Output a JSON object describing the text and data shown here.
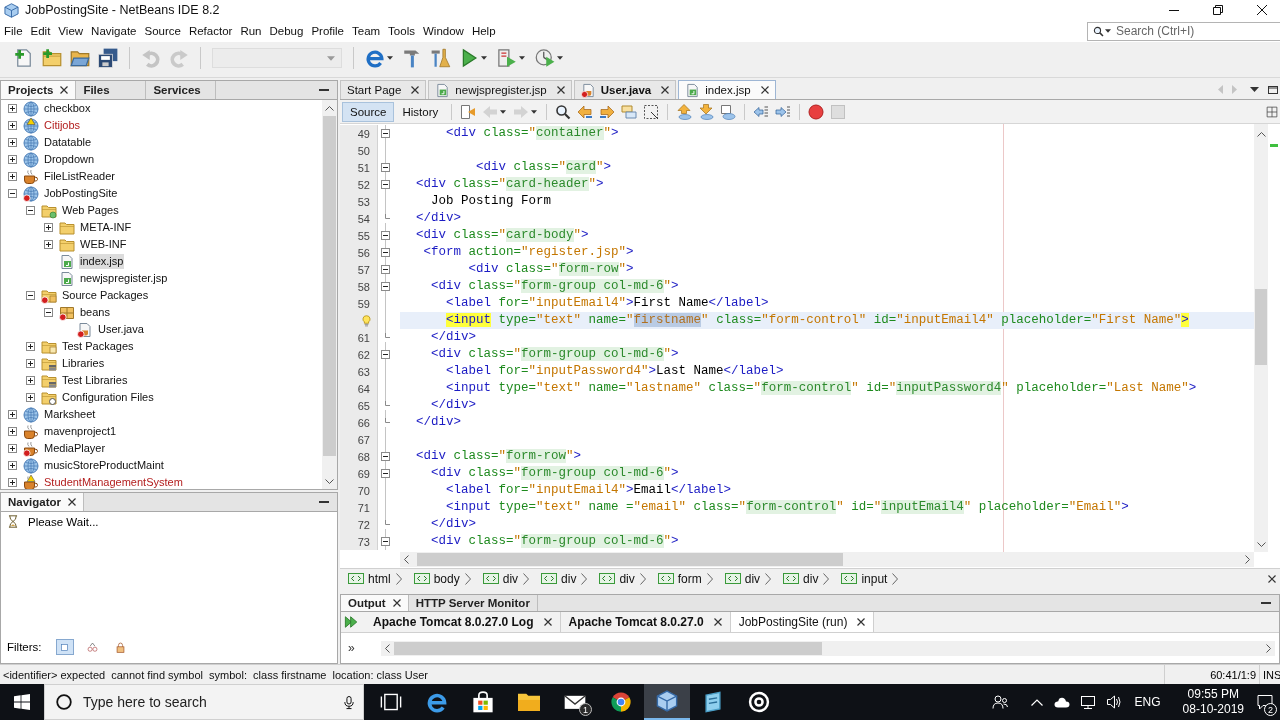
{
  "window": {
    "title": "JobPostingSite - NetBeans IDE 8.2"
  },
  "menu": [
    "File",
    "Edit",
    "View",
    "Navigate",
    "Source",
    "Refactor",
    "Run",
    "Debug",
    "Profile",
    "Team",
    "Tools",
    "Window",
    "Help"
  ],
  "search": {
    "placeholder": "Search (Ctrl+I)"
  },
  "toolbar": [
    {
      "kind": "new-file",
      "disabled": false
    },
    {
      "kind": "new-project",
      "disabled": false
    },
    {
      "kind": "open-project",
      "disabled": false
    },
    {
      "kind": "save-all",
      "disabled": false
    },
    {
      "kind": "separator"
    },
    {
      "kind": "undo",
      "disabled": true
    },
    {
      "kind": "redo",
      "disabled": true
    },
    {
      "kind": "separator"
    },
    {
      "kind": "configuration",
      "disabled": true
    },
    {
      "kind": "separator"
    },
    {
      "kind": "browser",
      "disabled": false
    },
    {
      "kind": "build",
      "disabled": false
    },
    {
      "kind": "clean-build",
      "disabled": false
    },
    {
      "kind": "run",
      "disabled": false
    },
    {
      "kind": "debug",
      "disabled": false
    },
    {
      "kind": "profile",
      "disabled": false
    }
  ],
  "projects": {
    "tabs": [
      {
        "label": "Projects",
        "selected": true,
        "closable": true
      },
      {
        "label": "Files",
        "selected": false,
        "closable": false
      },
      {
        "label": "Services",
        "selected": false,
        "closable": false
      }
    ],
    "tree": [
      {
        "label": "checkbox",
        "kind": "web-project",
        "broken": false,
        "has_errors": false,
        "expanded": false,
        "selected": false
      },
      {
        "label": "Citijobs",
        "kind": "web-project",
        "broken": true,
        "has_errors": false,
        "expanded": false,
        "selected": false
      },
      {
        "label": "Datatable",
        "kind": "web-project",
        "broken": false,
        "has_errors": false,
        "expanded": false,
        "selected": false
      },
      {
        "label": "Dropdown",
        "kind": "web-project",
        "broken": false,
        "has_errors": false,
        "expanded": false,
        "selected": false
      },
      {
        "label": "FileListReader",
        "kind": "java-project",
        "broken": false,
        "has_errors": false,
        "expanded": false,
        "selected": false
      },
      {
        "label": "JobPostingSite",
        "kind": "web-project",
        "broken": false,
        "has_errors": true,
        "expanded": true,
        "selected": false,
        "children": [
          {
            "label": "Web Pages",
            "kind": "web-folder",
            "broken": false,
            "has_errors": false,
            "expanded": true,
            "selected": false,
            "children": [
              {
                "label": "META-INF",
                "kind": "folder",
                "broken": false,
                "has_errors": false,
                "expanded": false,
                "selected": false
              },
              {
                "label": "WEB-INF",
                "kind": "folder",
                "broken": false,
                "has_errors": false,
                "expanded": false,
                "selected": false
              },
              {
                "label": "index.jsp",
                "kind": "jsp-file",
                "broken": false,
                "has_errors": false,
                "selected": true
              },
              {
                "label": "newjspregister.jsp",
                "kind": "jsp-file",
                "broken": false,
                "has_errors": false,
                "selected": false
              }
            ]
          },
          {
            "label": "Source Packages",
            "kind": "source-folder",
            "broken": false,
            "has_errors": true,
            "expanded": true,
            "selected": false,
            "children": [
              {
                "label": "beans",
                "kind": "package",
                "broken": false,
                "has_errors": true,
                "expanded": true,
                "selected": false,
                "children": [
                  {
                    "label": "User.java",
                    "kind": "java-file",
                    "broken": false,
                    "has_errors": true,
                    "selected": false
                  }
                ]
              }
            ]
          },
          {
            "label": "Test Packages",
            "kind": "test-folder",
            "broken": false,
            "has_errors": false,
            "expanded": false,
            "selected": false
          },
          {
            "label": "Libraries",
            "kind": "library-folder",
            "broken": false,
            "has_errors": false,
            "expanded": false,
            "selected": false
          },
          {
            "label": "Test Libraries",
            "kind": "library-folder",
            "broken": false,
            "has_errors": false,
            "expanded": false,
            "selected": false
          },
          {
            "label": "Configuration Files",
            "kind": "config-folder",
            "broken": false,
            "has_errors": false,
            "expanded": false,
            "selected": false
          }
        ]
      },
      {
        "label": "Marksheet",
        "kind": "web-project",
        "broken": false,
        "has_errors": false,
        "expanded": false,
        "selected": false
      },
      {
        "label": "mavenproject1",
        "kind": "java-project",
        "broken": false,
        "has_errors": false,
        "expanded": false,
        "selected": false
      },
      {
        "label": "MediaPlayer",
        "kind": "java-project",
        "broken": false,
        "has_errors": true,
        "expanded": false,
        "selected": false
      },
      {
        "label": "musicStoreProductMaint",
        "kind": "web-project",
        "broken": false,
        "has_errors": false,
        "expanded": false,
        "selected": false
      },
      {
        "label": "StudentManagementSystem",
        "kind": "java-project",
        "broken": true,
        "has_errors": false,
        "expanded": false,
        "selected": false
      }
    ]
  },
  "navigator": {
    "tabs": [
      {
        "label": "Navigator",
        "selected": true,
        "closable": true
      }
    ],
    "message": "Please Wait...",
    "filters_label": "Filters:",
    "filters": [
      {
        "kind": "fields",
        "selected": true
      },
      {
        "kind": "inherited",
        "selected": false
      },
      {
        "kind": "non-public",
        "selected": false
      }
    ]
  },
  "editor": {
    "tabs": [
      {
        "label": "Start Page",
        "kind": "page",
        "modified": false,
        "selected": false
      },
      {
        "label": "newjspregister.jsp",
        "kind": "jsp-file",
        "has_errors": false,
        "modified": false,
        "selected": false
      },
      {
        "label": "User.java",
        "kind": "java-file",
        "has_errors": true,
        "modified": true,
        "selected": false
      },
      {
        "label": "index.jsp",
        "kind": "jsp-file",
        "has_errors": false,
        "modified": false,
        "selected": true
      }
    ],
    "views": [
      {
        "label": "Source",
        "selected": true
      },
      {
        "label": "History",
        "selected": false
      }
    ],
    "toolbar": [
      {
        "kind": "last-edit",
        "disabled": false
      },
      {
        "kind": "back",
        "disabled": true
      },
      {
        "kind": "forward",
        "disabled": true
      },
      {
        "kind": "separator"
      },
      {
        "kind": "find",
        "disabled": false
      },
      {
        "kind": "find-previous",
        "disabled": false
      },
      {
        "kind": "find-next",
        "disabled": false
      },
      {
        "kind": "highlight",
        "disabled": false
      },
      {
        "kind": "rect-select",
        "disabled": false
      },
      {
        "kind": "separator"
      },
      {
        "kind": "bookmark-previous",
        "disabled": false
      },
      {
        "kind": "bookmark-next",
        "disabled": false
      },
      {
        "kind": "bookmark-toggle",
        "disabled": false
      },
      {
        "kind": "separator"
      },
      {
        "kind": "shift-left",
        "disabled": false
      },
      {
        "kind": "shift-right",
        "disabled": false
      },
      {
        "kind": "separator"
      },
      {
        "kind": "record",
        "disabled": false
      },
      {
        "kind": "stop",
        "disabled": true
      }
    ],
    "lines": [
      {
        "number": "49",
        "kind": "fold-start",
        "hint": false,
        "current": false,
        "tokens": [
          {
            "kind": "tag",
            "text": "      <div"
          },
          {
            "kind": "attr",
            "text": " class="
          },
          {
            "kind": "value",
            "text": "\""
          },
          {
            "kind": "css",
            "text": "container"
          },
          {
            "kind": "value",
            "text": "\""
          },
          {
            "kind": "tag",
            "text": ">"
          }
        ]
      },
      {
        "number": "50",
        "kind": "plain",
        "hint": false,
        "current": false
      },
      {
        "number": "51",
        "kind": "fold-start",
        "hint": false,
        "current": false,
        "tokens": [
          {
            "kind": "tag",
            "text": "          <div"
          },
          {
            "kind": "attr",
            "text": " class="
          },
          {
            "kind": "value",
            "text": "\""
          },
          {
            "kind": "css",
            "text": "card"
          },
          {
            "kind": "value",
            "text": "\""
          },
          {
            "kind": "tag",
            "text": ">"
          }
        ]
      },
      {
        "number": "52",
        "kind": "fold-start",
        "hint": false,
        "current": false,
        "tokens": [
          {
            "kind": "tag",
            "text": "  <div"
          },
          {
            "kind": "attr",
            "text": " class="
          },
          {
            "kind": "value",
            "text": "\""
          },
          {
            "kind": "css",
            "text": "card-header"
          },
          {
            "kind": "value",
            "text": "\""
          },
          {
            "kind": "tag",
            "text": ">"
          }
        ]
      },
      {
        "number": "53",
        "kind": "plain",
        "hint": false,
        "current": false,
        "tokens": [
          {
            "kind": "text",
            "text": "    Job Posting Form"
          }
        ]
      },
      {
        "number": "54",
        "kind": "fold-end",
        "hint": false,
        "current": false,
        "tokens": [
          {
            "kind": "tag",
            "text": "  </div>"
          }
        ]
      },
      {
        "number": "55",
        "kind": "fold-start",
        "hint": false,
        "current": false,
        "tokens": [
          {
            "kind": "tag",
            "text": "  <div"
          },
          {
            "kind": "attr",
            "text": " class="
          },
          {
            "kind": "value",
            "text": "\""
          },
          {
            "kind": "css",
            "text": "card-body"
          },
          {
            "kind": "value",
            "text": "\""
          },
          {
            "kind": "tag",
            "text": ">"
          }
        ]
      },
      {
        "number": "56",
        "kind": "fold-start",
        "hint": false,
        "current": false,
        "tokens": [
          {
            "kind": "tag",
            "text": "   <form"
          },
          {
            "kind": "attr",
            "text": " action="
          },
          {
            "kind": "value",
            "text": "\"register.jsp\""
          },
          {
            "kind": "tag",
            "text": ">"
          }
        ]
      },
      {
        "number": "57",
        "kind": "fold-start",
        "hint": false,
        "current": false,
        "tokens": [
          {
            "kind": "tag",
            "text": "         <div"
          },
          {
            "kind": "attr",
            "text": " class="
          },
          {
            "kind": "value",
            "text": "\""
          },
          {
            "kind": "css",
            "text": "form-row"
          },
          {
            "kind": "value",
            "text": "\""
          },
          {
            "kind": "tag",
            "text": ">"
          }
        ]
      },
      {
        "number": "58",
        "kind": "fold-start",
        "hint": false,
        "current": false,
        "tokens": [
          {
            "kind": "tag",
            "text": "    <div"
          },
          {
            "kind": "attr",
            "text": " class="
          },
          {
            "kind": "value",
            "text": "\""
          },
          {
            "kind": "css",
            "text": "form-group col-md-6"
          },
          {
            "kind": "value",
            "text": "\""
          },
          {
            "kind": "tag",
            "text": ">"
          }
        ]
      },
      {
        "number": "59",
        "kind": "plain",
        "hint": false,
        "current": false,
        "tokens": [
          {
            "kind": "tag",
            "text": "      <label"
          },
          {
            "kind": "attr",
            "text": " for="
          },
          {
            "kind": "value",
            "text": "\"inputEmail4\""
          },
          {
            "kind": "tag",
            "text": ">"
          },
          {
            "kind": "text",
            "text": "First Name"
          },
          {
            "kind": "tag",
            "text": "</label>"
          }
        ]
      },
      {
        "kind": "plain",
        "hint": true,
        "current": true,
        "tokens": [
          {
            "kind": "match",
            "text": "      <input"
          },
          {
            "kind": "attr",
            "text": " type="
          },
          {
            "kind": "value",
            "text": "\"text\""
          },
          {
            "kind": "attr",
            "text": " name="
          },
          {
            "kind": "value",
            "text": "\""
          },
          {
            "kind": "selected",
            "text": "firstname"
          },
          {
            "kind": "value",
            "text": "\""
          },
          {
            "kind": "attr",
            "text": " class="
          },
          {
            "kind": "value",
            "text": "\"form-control\""
          },
          {
            "kind": "attr",
            "text": " id="
          },
          {
            "kind": "value",
            "text": "\"inputEmail4\""
          },
          {
            "kind": "attr",
            "text": " placeholder="
          },
          {
            "kind": "value",
            "text": "\"First Name\""
          },
          {
            "kind": "match",
            "text": ">"
          }
        ]
      },
      {
        "number": "61",
        "kind": "fold-end",
        "hint": false,
        "current": false,
        "tokens": [
          {
            "kind": "tag",
            "text": "    </div>"
          }
        ]
      },
      {
        "number": "62",
        "kind": "fold-start",
        "hint": false,
        "current": false,
        "tokens": [
          {
            "kind": "tag",
            "text": "    <div"
          },
          {
            "kind": "attr",
            "text": " class="
          },
          {
            "kind": "value",
            "text": "\""
          },
          {
            "kind": "css",
            "text": "form-group col-md-6"
          },
          {
            "kind": "value",
            "text": "\""
          },
          {
            "kind": "tag",
            "text": ">"
          }
        ]
      },
      {
        "number": "63",
        "kind": "plain",
        "hint": false,
        "current": false,
        "tokens": [
          {
            "kind": "tag",
            "text": "      <label"
          },
          {
            "kind": "attr",
            "text": " for="
          },
          {
            "kind": "value",
            "text": "\"inputPassword4\""
          },
          {
            "kind": "tag",
            "text": ">"
          },
          {
            "kind": "text",
            "text": "Last Name"
          },
          {
            "kind": "tag",
            "text": "</label>"
          }
        ]
      },
      {
        "number": "64",
        "kind": "plain",
        "hint": false,
        "current": false,
        "tokens": [
          {
            "kind": "tag",
            "text": "      <input"
          },
          {
            "kind": "attr",
            "text": " type="
          },
          {
            "kind": "value",
            "text": "\"text\""
          },
          {
            "kind": "attr",
            "text": " name="
          },
          {
            "kind": "value",
            "text": "\"lastname\""
          },
          {
            "kind": "attr",
            "text": " class="
          },
          {
            "kind": "value",
            "text": "\""
          },
          {
            "kind": "css",
            "text": "form-control"
          },
          {
            "kind": "value",
            "text": "\""
          },
          {
            "kind": "attr",
            "text": " id="
          },
          {
            "kind": "value",
            "text": "\""
          },
          {
            "kind": "css",
            "text": "inputPassword4"
          },
          {
            "kind": "value",
            "text": "\""
          },
          {
            "kind": "attr",
            "text": " placeholder="
          },
          {
            "kind": "value",
            "text": "\"Last Name\""
          },
          {
            "kind": "tag",
            "text": ">"
          }
        ]
      },
      {
        "number": "65",
        "kind": "fold-end",
        "hint": false,
        "current": false,
        "tokens": [
          {
            "kind": "tag",
            "text": "    </div>"
          }
        ]
      },
      {
        "number": "66",
        "kind": "fold-end",
        "hint": false,
        "current": false,
        "tokens": [
          {
            "kind": "tag",
            "text": "  </div>"
          }
        ]
      },
      {
        "number": "67",
        "kind": "plain",
        "hint": false,
        "current": false
      },
      {
        "number": "68",
        "kind": "fold-start",
        "hint": false,
        "current": false,
        "tokens": [
          {
            "kind": "tag",
            "text": "  <div"
          },
          {
            "kind": "attr",
            "text": " class="
          },
          {
            "kind": "value",
            "text": "\""
          },
          {
            "kind": "css",
            "text": "form-row"
          },
          {
            "kind": "value",
            "text": "\""
          },
          {
            "kind": "tag",
            "text": ">"
          }
        ]
      },
      {
        "number": "69",
        "kind": "fold-start",
        "hint": false,
        "current": false,
        "tokens": [
          {
            "kind": "tag",
            "text": "    <div"
          },
          {
            "kind": "attr",
            "text": " class="
          },
          {
            "kind": "value",
            "text": "\""
          },
          {
            "kind": "css",
            "text": "form-group col-md-6"
          },
          {
            "kind": "value",
            "text": "\""
          },
          {
            "kind": "tag",
            "text": ">"
          }
        ]
      },
      {
        "number": "70",
        "kind": "plain",
        "hint": false,
        "current": false,
        "tokens": [
          {
            "kind": "tag",
            "text": "      <label"
          },
          {
            "kind": "attr",
            "text": " for="
          },
          {
            "kind": "value",
            "text": "\"inputEmail4\""
          },
          {
            "kind": "tag",
            "text": ">"
          },
          {
            "kind": "text",
            "text": "Email"
          },
          {
            "kind": "tag",
            "text": "</label>"
          }
        ]
      },
      {
        "number": "71",
        "kind": "plain",
        "hint": false,
        "current": false,
        "tokens": [
          {
            "kind": "tag",
            "text": "      <input"
          },
          {
            "kind": "attr",
            "text": " type="
          },
          {
            "kind": "value",
            "text": "\"text\""
          },
          {
            "kind": "attr",
            "text": " name ="
          },
          {
            "kind": "value",
            "text": "\"email\""
          },
          {
            "kind": "attr",
            "text": " class="
          },
          {
            "kind": "value",
            "text": "\""
          },
          {
            "kind": "css",
            "text": "form-control"
          },
          {
            "kind": "value",
            "text": "\""
          },
          {
            "kind": "attr",
            "text": " id="
          },
          {
            "kind": "value",
            "text": "\""
          },
          {
            "kind": "css",
            "text": "inputEmail4"
          },
          {
            "kind": "value",
            "text": "\""
          },
          {
            "kind": "attr",
            "text": " placeholder="
          },
          {
            "kind": "value",
            "text": "\"Email\""
          },
          {
            "kind": "tag",
            "text": ">"
          }
        ]
      },
      {
        "number": "72",
        "kind": "fold-end",
        "hint": false,
        "current": false,
        "tokens": [
          {
            "kind": "tag",
            "text": "    </div>"
          }
        ]
      },
      {
        "number": "73",
        "kind": "fold-start",
        "hint": false,
        "current": false,
        "tokens": [
          {
            "kind": "tag",
            "text": "    <div"
          },
          {
            "kind": "attr",
            "text": " class="
          },
          {
            "kind": "value",
            "text": "\""
          },
          {
            "kind": "css",
            "text": "form-group col-md-6"
          },
          {
            "kind": "value",
            "text": "\""
          },
          {
            "kind": "tag",
            "text": ">"
          }
        ]
      }
    ],
    "breadcrumbs": [
      "html",
      "body",
      "div",
      "div",
      "div",
      "form",
      "div",
      "div",
      "input"
    ]
  },
  "output": {
    "tabs": [
      {
        "label": "Output",
        "selected": true,
        "closable": true
      },
      {
        "label": "HTTP Server Monitor",
        "selected": false,
        "closable": false
      }
    ],
    "consoles": [
      {
        "label": "Apache Tomcat 8.0.27.0 Log",
        "unread": true,
        "selected": false
      },
      {
        "label": "Apache Tomcat 8.0.27.0",
        "unread": true,
        "selected": false
      },
      {
        "label": "JobPostingSite (run)",
        "unread": false,
        "selected": true
      }
    ],
    "overflow": "»"
  },
  "status_bar": {
    "message": "<identifier> expected  cannot find symbol  symbol:  class firstname  location: class User",
    "position": "60:41/1:9",
    "mode": "INS"
  },
  "taskbar": {
    "search": {
      "placeholder": "Type here to search"
    },
    "apps": [
      {
        "kind": "task-view",
        "active": false
      },
      {
        "kind": "edge",
        "active": false
      },
      {
        "kind": "store",
        "active": false
      },
      {
        "kind": "explorer",
        "active": false
      },
      {
        "kind": "mail",
        "active": false,
        "badge": "1"
      },
      {
        "kind": "chrome",
        "active": false
      },
      {
        "kind": "netbeans",
        "active": true
      },
      {
        "kind": "notes",
        "active": false
      },
      {
        "kind": "ring",
        "active": false
      }
    ],
    "tray": {
      "language": "ENG",
      "time": "09:55 PM",
      "date": "08-10-2019",
      "notifications": "2"
    }
  }
}
